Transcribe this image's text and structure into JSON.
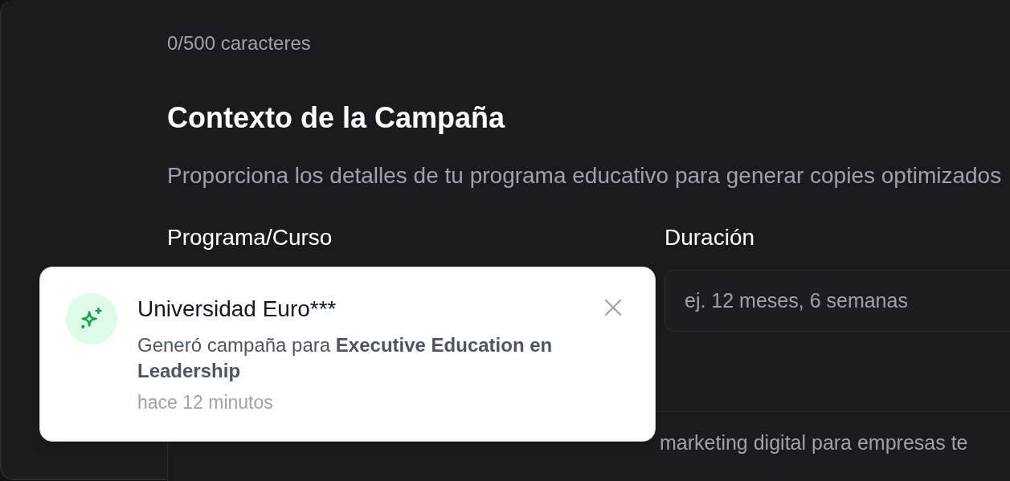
{
  "counter": "0/500 caracteres",
  "section": {
    "title": "Contexto de la Campaña",
    "description": "Proporciona los detalles de tu programa educativo para generar copies optimizados"
  },
  "fields": [
    {
      "label": "Programa/Curso"
    },
    {
      "label": "Duración",
      "placeholder": "ej. 12 meses, 6 semanas"
    }
  ],
  "objective": {
    "placeholder": "marketing digital para empresas te"
  },
  "toast": {
    "title": "Universidad Euro***",
    "message": "Generó campaña para **Executive Education en Leadership**",
    "time": "hace 12 minutos"
  }
}
